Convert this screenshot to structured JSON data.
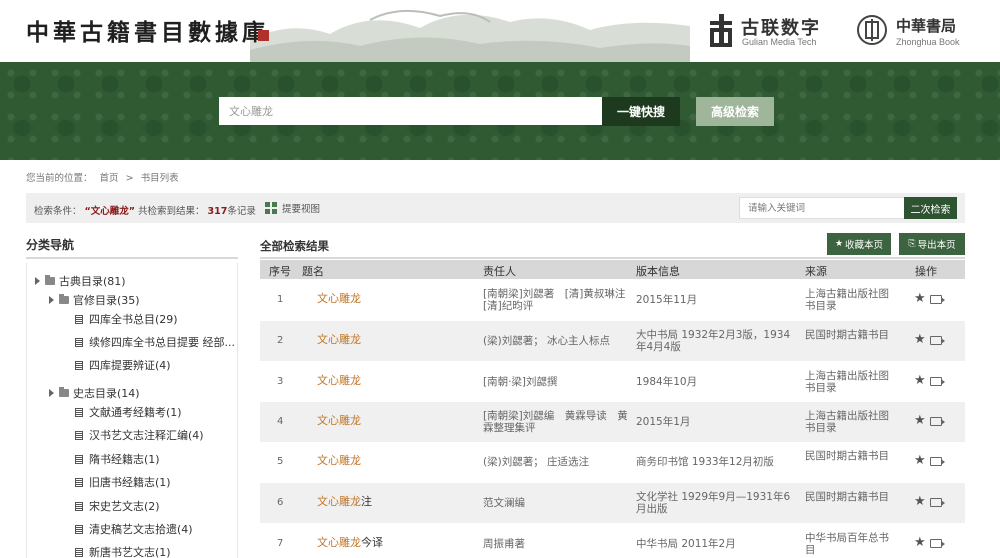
{
  "header": {
    "site_title": "中華古籍書目數據庫",
    "logo_gulian_cn": "古联数字",
    "logo_gulian_en": "Gulian Media Tech",
    "logo_zhonghua_cn": "中華書局",
    "logo_zhonghua_en": "Zhonghua Book"
  },
  "search": {
    "value": "文心雕龙",
    "quick_button": "一键快搜",
    "advanced_button": "高级检索"
  },
  "breadcrumb": {
    "prefix": "您当前的位置：",
    "home": "首页",
    "sep": ">",
    "current": "书目列表"
  },
  "condition": {
    "label": "检索条件：",
    "keyword": "“文心雕龙”",
    "found_label": "共检索到结果：",
    "count": "317",
    "unit": "条记录",
    "view_toggle": "提要视图",
    "secondary_placeholder": "请输入关键词",
    "secondary_button": "二次检索"
  },
  "sidebar": {
    "title": "分类导航",
    "nodes": [
      {
        "label": "古典目录(81)",
        "kind": "folder"
      },
      {
        "label": "官修目录(35)",
        "kind": "folder"
      },
      {
        "label": "四库全书总目(29)",
        "kind": "doc"
      },
      {
        "label": "续修四库全书总目提要 经部...",
        "kind": "doc"
      },
      {
        "label": "四库提要辨证(4)",
        "kind": "doc"
      },
      {
        "label": "史志目录(14)",
        "kind": "folder"
      },
      {
        "label": "文献通考经籍考(1)",
        "kind": "doc"
      },
      {
        "label": "汉书艺文志注释汇编(4)",
        "kind": "doc"
      },
      {
        "label": "隋书经籍志(1)",
        "kind": "doc"
      },
      {
        "label": "旧唐书经籍志(1)",
        "kind": "doc"
      },
      {
        "label": "宋史艺文志(2)",
        "kind": "doc"
      },
      {
        "label": "清史稿艺文志拾遗(4)",
        "kind": "doc"
      },
      {
        "label": "新唐书艺文志(1)",
        "kind": "doc"
      }
    ]
  },
  "results": {
    "title": "全部检索结果",
    "fav_button": "收藏本页",
    "export_button": "导出本页",
    "columns": [
      "序号",
      "题名",
      "责任人",
      "版本信息",
      "来源",
      "操作"
    ],
    "rows": [
      {
        "no": "1",
        "title_hl": "文心雕龙",
        "title_rest": "",
        "resp": "[南朝梁]刘勰著　[清]黄叔琳注　[清]纪昀评",
        "edition": "2015年11月",
        "source": "上海古籍出版社图书目录"
      },
      {
        "no": "2",
        "title_hl": "文心雕龙",
        "title_rest": "",
        "resp": "(梁)刘勰著； 冰心主人标点",
        "edition": "大中书局 1932年2月3版，1934年4月4版",
        "source": "民国时期古籍书目"
      },
      {
        "no": "3",
        "title_hl": "文心雕龙",
        "title_rest": "",
        "resp": "[南朝·梁]刘勰撰",
        "edition": "1984年10月",
        "source": "上海古籍出版社图书目录"
      },
      {
        "no": "4",
        "title_hl": "文心雕龙",
        "title_rest": "",
        "resp": "[南朝梁]刘勰编　黄霖导读　黄霖整理集评",
        "edition": "2015年1月",
        "source": "上海古籍出版社图书目录"
      },
      {
        "no": "5",
        "title_hl": "文心雕龙",
        "title_rest": "",
        "resp": "(梁)刘勰著； 庄适选注",
        "edition": "商务印书馆 1933年12月初版",
        "source": "民国时期古籍书目"
      },
      {
        "no": "6",
        "title_hl": "文心雕龙",
        "title_rest": "注",
        "resp": "范文澜编",
        "edition": "文化学社 1929年9月—1931年6月出版",
        "source": "民国时期古籍书目"
      },
      {
        "no": "7",
        "title_hl": "文心雕龙",
        "title_rest": "今译",
        "resp": "周振甫著",
        "edition": "中华书局 2011年2月",
        "source": "中华书局百年总书目"
      }
    ]
  },
  "colors": {
    "brand_green": "#2f5a32",
    "dark_green": "#1d3a1f",
    "highlight": "#c0772a",
    "keyword_red": "#8a1a1a"
  }
}
